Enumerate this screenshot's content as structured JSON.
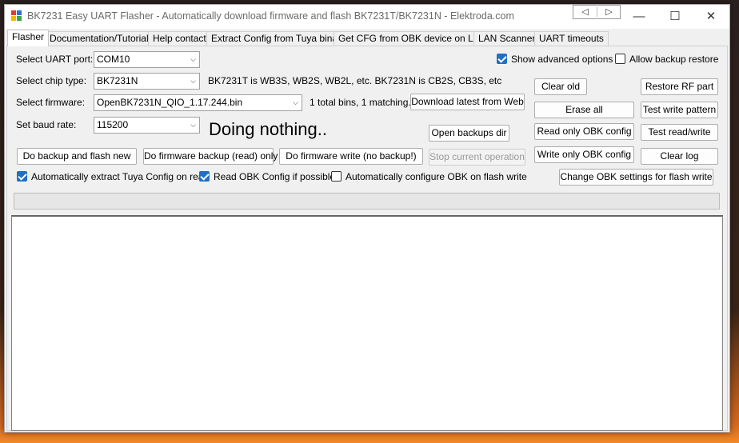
{
  "window": {
    "title": "BK7231 Easy UART Flasher - Automatically download firmware and flash BK7231T/BK7231N  - Elektroda.com",
    "nav_prev": "◁",
    "nav_next": "▷",
    "minimize": "—",
    "maximize": "☐",
    "close": "✕"
  },
  "tabs": [
    {
      "label": "Flasher"
    },
    {
      "label": "Documentation/Tutorials"
    },
    {
      "label": "Help contact"
    },
    {
      "label": "Extract Config from Tuya binary"
    },
    {
      "label": "Get CFG from OBK device on LAN"
    },
    {
      "label": "LAN Scanner"
    },
    {
      "label": "UART timeouts"
    }
  ],
  "form": {
    "uart_label": "Select UART port:",
    "uart_value": "COM10",
    "chip_label": "Select chip type:",
    "chip_value": "BK7231N",
    "chip_info": "BK7231T is WB3S, WB2S, WB2L, etc. BK7231N is CB2S, CB3S, etc",
    "firmware_label": "Select firmware:",
    "firmware_value": "OpenBK7231N_QIO_1.17.244.bin",
    "firmware_info": "1 total bins, 1 matching.",
    "baud_label": "Set baud rate:",
    "baud_value": "115200",
    "status": "Doing nothing.."
  },
  "options": {
    "show_advanced": {
      "label": "Show advanced options",
      "checked": true
    },
    "allow_backup_restore": {
      "label": "Allow backup restore",
      "checked": false
    },
    "auto_extract_tuya": {
      "label": "Automatically extract Tuya Config on read",
      "checked": true
    },
    "read_obk_config": {
      "label": "Read OBK Config if possible",
      "checked": true
    },
    "auto_configure_obk": {
      "label": "Automatically configure OBK on flash write",
      "checked": false
    }
  },
  "buttons": {
    "download_latest": "Download latest from Web",
    "open_backups_dir": "Open backups dir",
    "backup_and_flash": "Do backup and flash new",
    "firmware_backup": "Do firmware backup (read) only",
    "firmware_write": "Do firmware write (no backup!)",
    "stop": "Stop current operation",
    "clear_old": "Clear old",
    "restore_rf": "Restore RF part",
    "erase_all": "Erase all",
    "test_write_pattern": "Test write pattern",
    "read_only_obk": "Read only OBK config",
    "test_read_write": "Test read/write",
    "write_only_obk": "Write only OBK config",
    "clear_log": "Clear log",
    "change_obk_settings": "Change OBK settings for flash write"
  },
  "progress": {
    "percent": 0
  },
  "colors": {
    "checkbox_accent": "#1f6fc5",
    "icon_red": "#e33b2e",
    "icon_blue": "#2f6fd6",
    "icon_yellow": "#f2b705",
    "icon_green": "#3aa64a"
  },
  "icons": {
    "app": "app-icon",
    "combo_arrow": "chevron-down-icon"
  }
}
